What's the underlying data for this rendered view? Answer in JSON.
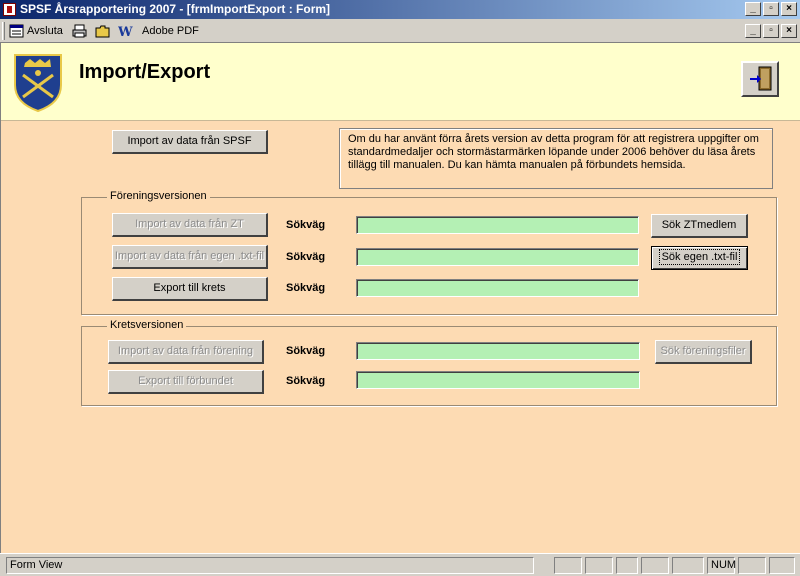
{
  "window": {
    "title": "SPSF Årsrapportering 2007 - [frmImportExport : Form]"
  },
  "window_controls": {
    "minimize": "_",
    "restore": "▫",
    "close": "×"
  },
  "toolbar": {
    "avsluta_label": "Avsluta",
    "adobe_label": "Adobe PDF"
  },
  "header": {
    "title": "Import/Export"
  },
  "main": {
    "import_spsf_label": "Import av data från SPSF",
    "info_text": "Om du har använt förra årets version av detta program för att registrera uppgifter om standardmedaljer och stormästarmärken löpande under 2006 behöver du läsa årets tillägg till manualen. Du kan hämta manualen på förbundets hemsida."
  },
  "forening": {
    "group_label": "Föreningsversionen",
    "import_zt_label": "Import av data från ZT",
    "import_txt_label": "Import av data från  egen .txt-fil",
    "export_krets_label": "Export till krets",
    "path_label": "Sökväg",
    "sok_zt_label": "Sök ZTmedlem",
    "sok_txt_label": "Sök egen .txt-fil",
    "path_zt_value": "",
    "path_txt_value": "",
    "path_export_value": ""
  },
  "krets": {
    "group_label": "Kretsversionen",
    "import_forening_label": "Import av data från förening",
    "export_forbund_label": "Export till förbundet",
    "path_label": "Sökväg",
    "sok_foreningsfiler_label": "Sök föreningsfiler",
    "path_import_value": "",
    "path_export_value": ""
  },
  "statusbar": {
    "view_mode": "Form View",
    "num": "NUM"
  },
  "colors": {
    "form_bg": "#fddbb3",
    "header_bg": "#ffffcc",
    "field_bg": "#b4f0b4",
    "titlebar": "#0a246a"
  }
}
